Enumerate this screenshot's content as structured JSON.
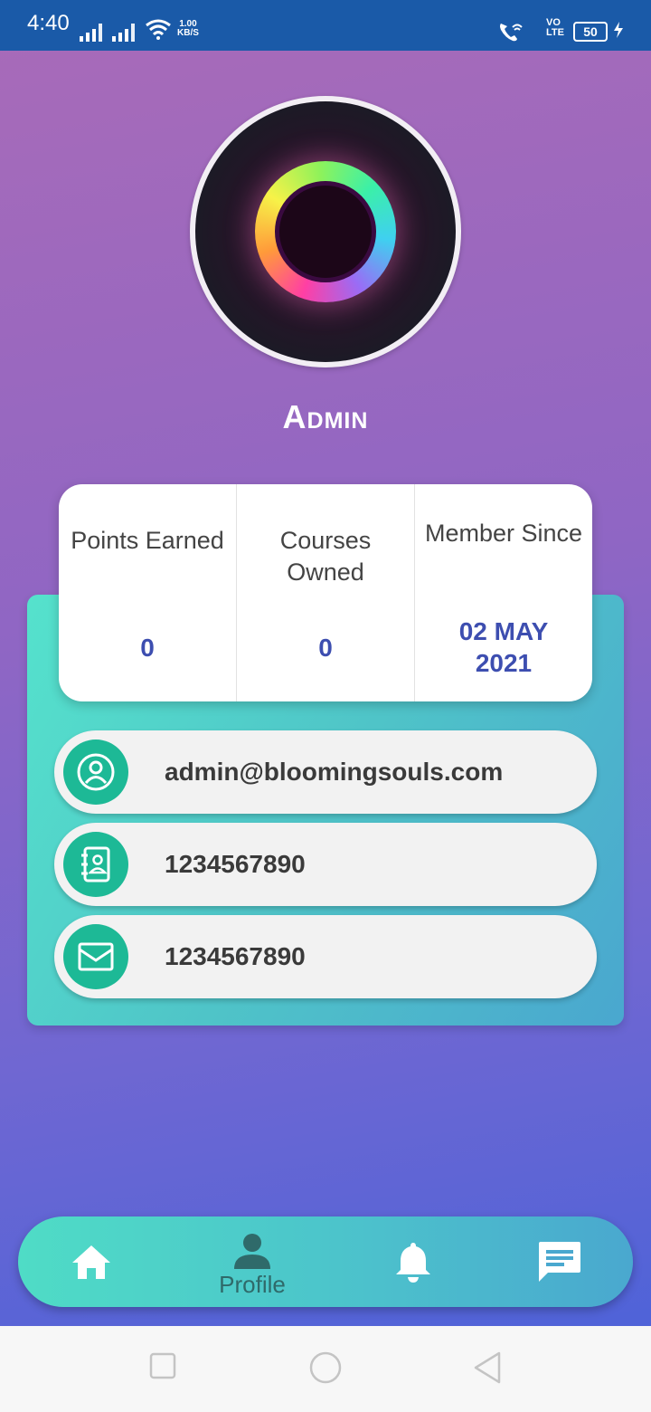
{
  "status_bar": {
    "time": "4:40",
    "net_speed_value": "1.00",
    "net_speed_unit": "KB/S",
    "volte_line1": "VO",
    "volte_line2": "LTE",
    "battery": "50"
  },
  "profile": {
    "username": "Admin"
  },
  "stats": [
    {
      "label": "Points Earned",
      "value": "0"
    },
    {
      "label": "Courses Owned",
      "value": "0"
    },
    {
      "label": "Member Since",
      "value": "02 MAY 2021"
    }
  ],
  "contact": {
    "email": "admin@bloomingsouls.com",
    "phone": "1234567890",
    "mail_field": "1234567890"
  },
  "bottom_nav": {
    "items": [
      {
        "icon": "home-icon",
        "label": ""
      },
      {
        "icon": "person-icon",
        "label": "Profile"
      },
      {
        "icon": "bell-icon",
        "label": ""
      },
      {
        "icon": "chat-icon",
        "label": ""
      }
    ],
    "active_index": 1
  },
  "colors": {
    "status_bar": "#1a5aa8",
    "accent_teal": "#1db996",
    "value_blue": "#3d4eb0"
  }
}
